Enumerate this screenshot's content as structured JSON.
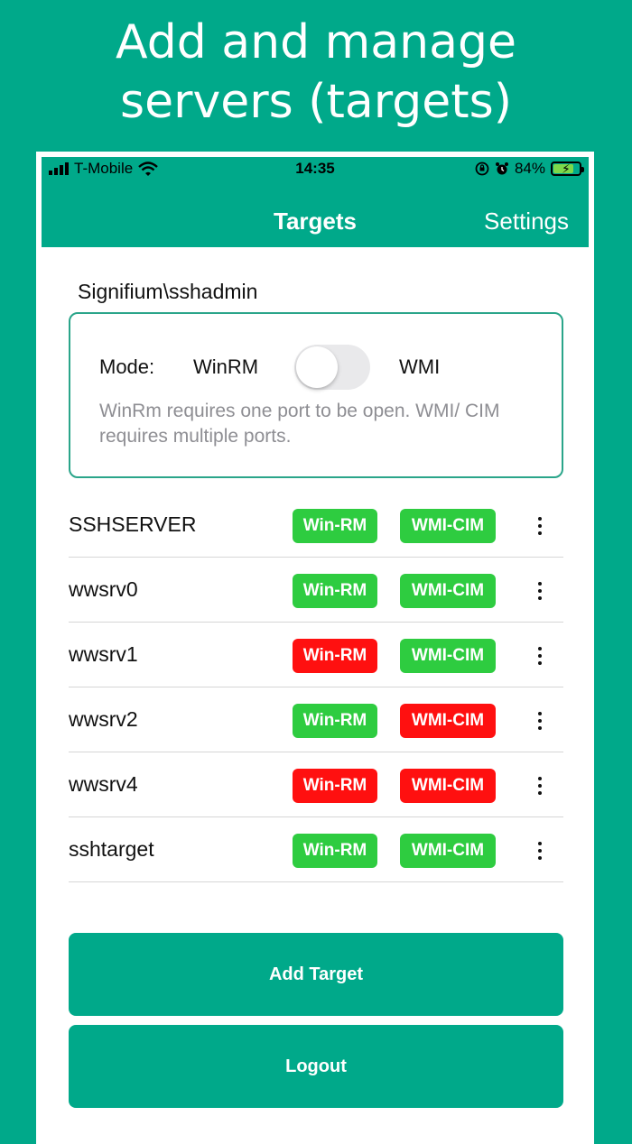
{
  "headline": {
    "line1": "Add and manage",
    "line2": "servers (targets)"
  },
  "status_bar": {
    "carrier": "T-Mobile",
    "time": "14:35",
    "battery": "84%",
    "battery_level": 0.84
  },
  "nav": {
    "title": "Targets",
    "settings_label": "Settings"
  },
  "user": {
    "name": "Signifium\\sshadmin"
  },
  "mode": {
    "label": "Mode:",
    "left_option": "WinRM",
    "right_option": "WMI",
    "toggle_on": false,
    "note": "WinRm requires one port to be open. WMI/ CIM requires multiple ports."
  },
  "colors": {
    "brand": "#00a98a",
    "ok": "#2ecc40",
    "error": "#ff1010"
  },
  "targets": [
    {
      "name": "SSHSERVER",
      "winrm_label": "Win-RM",
      "winrm_ok": true,
      "wmi_label": "WMI-CIM",
      "wmi_ok": true
    },
    {
      "name": "wwsrv0",
      "winrm_label": "Win-RM",
      "winrm_ok": true,
      "wmi_label": "WMI-CIM",
      "wmi_ok": true
    },
    {
      "name": "wwsrv1",
      "winrm_label": "Win-RM",
      "winrm_ok": false,
      "wmi_label": "WMI-CIM",
      "wmi_ok": true
    },
    {
      "name": "wwsrv2",
      "winrm_label": "Win-RM",
      "winrm_ok": true,
      "wmi_label": "WMI-CIM",
      "wmi_ok": false
    },
    {
      "name": "wwsrv4",
      "winrm_label": "Win-RM",
      "winrm_ok": false,
      "wmi_label": "WMI-CIM",
      "wmi_ok": false
    },
    {
      "name": "sshtarget",
      "winrm_label": "Win-RM",
      "winrm_ok": true,
      "wmi_label": "WMI-CIM",
      "wmi_ok": true
    }
  ],
  "buttons": {
    "add_target": "Add Target",
    "logout": "Logout"
  }
}
